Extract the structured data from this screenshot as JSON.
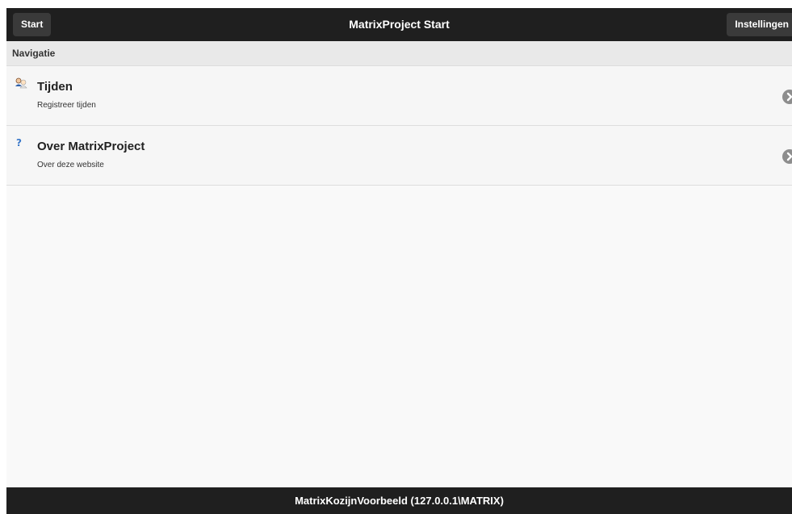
{
  "header": {
    "start_label": "Start",
    "title": "MatrixProject Start",
    "settings_label": "Instellingen"
  },
  "navigation": {
    "divider_label": "Navigatie",
    "items": [
      {
        "title": "Tijden",
        "description": "Registreer tijden",
        "icon": "users-icon"
      },
      {
        "title": "Over MatrixProject",
        "description": "Over deze website",
        "icon": "question-icon"
      }
    ]
  },
  "footer": {
    "text": "MatrixKozijnVoorbeeld (127.0.0.1\\MATRIX)"
  },
  "colors": {
    "header_bg": "#1f1f1f",
    "button_bg": "#3a3a3a",
    "divider_bg": "#e9e9e9",
    "list_bg": "#f6f6f6",
    "chevron": "#8d8d8d"
  }
}
